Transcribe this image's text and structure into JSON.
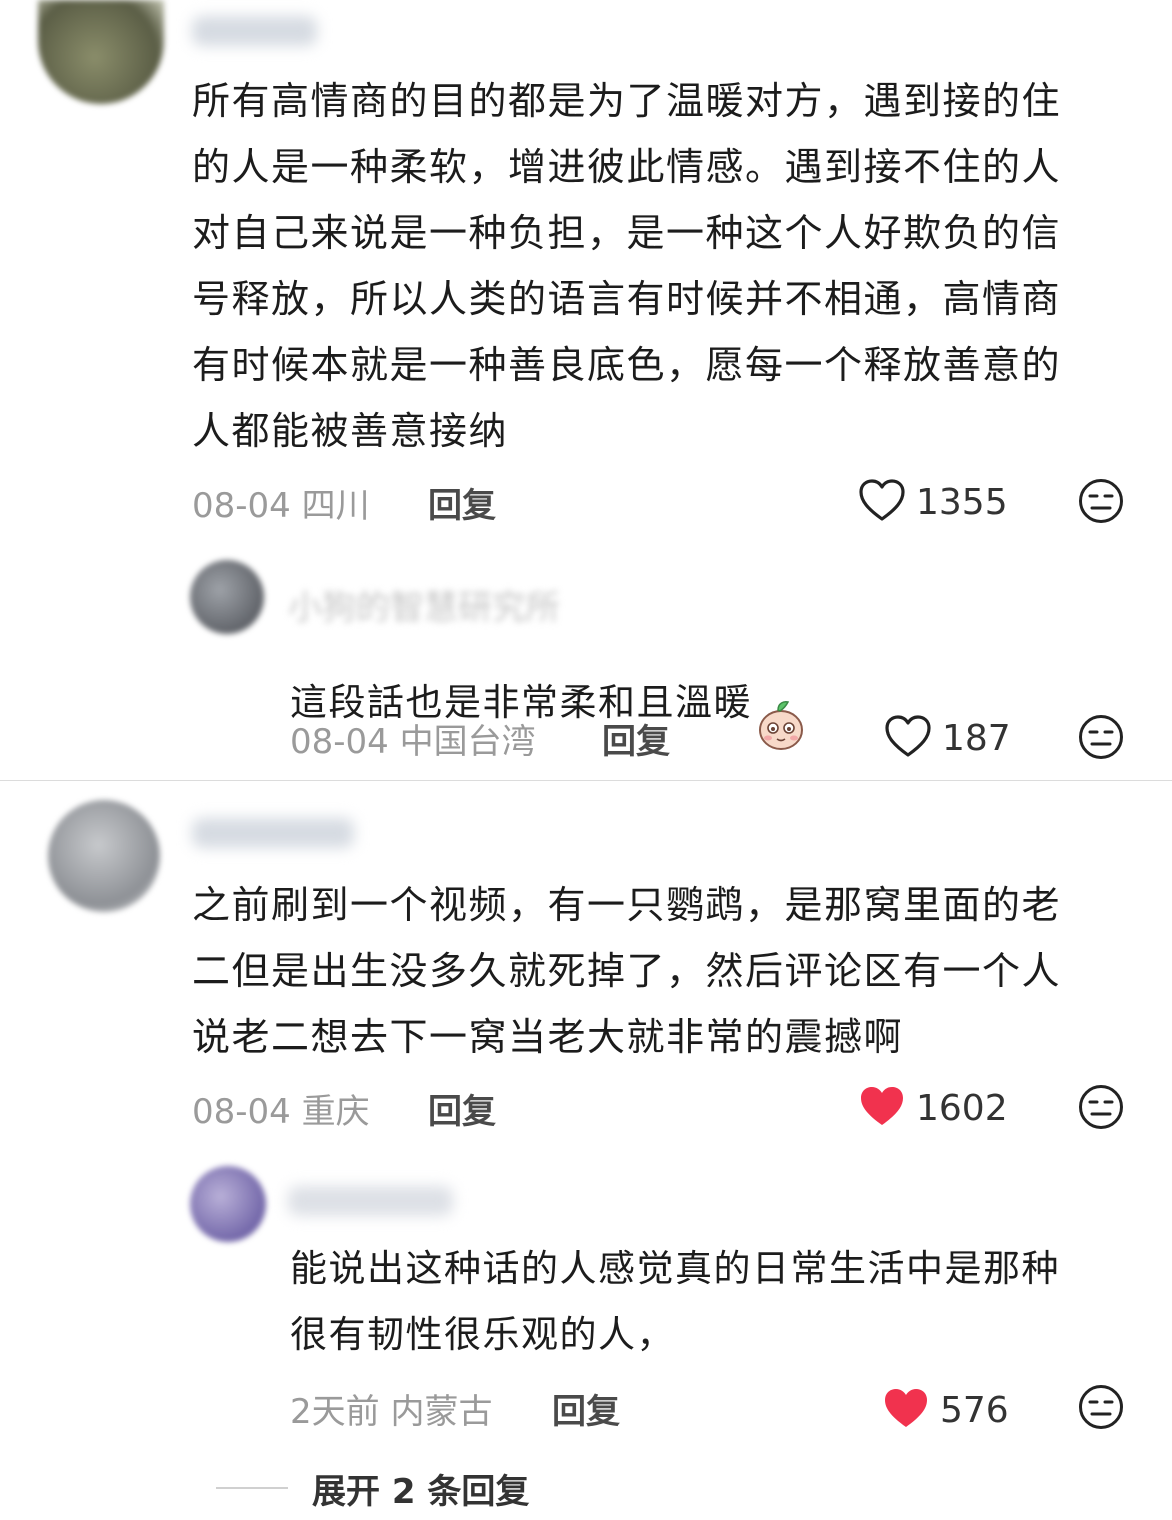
{
  "comments": [
    {
      "text": "所有高情商的目的都是为了温暖对方，遇到接的住\n的人是一种柔软，增进彼此情感。遇到接不住的人\n对自己来说是一种负担，是一种这个人好欺负的信\n号释放，所以人类的语言有时候并不相通，高情商\n有时候本就是一种善良底色，愿每一个释放善意的\n人都能被善意接纳",
      "meta": "08-04 四川",
      "reply": "回复",
      "likes": "1355",
      "liked": false
    },
    {
      "author": "小狗的智慧研究所",
      "text": "這段話也是非常柔和且溫暖",
      "meta": "08-04 中国台湾",
      "reply": "回复",
      "likes": "187",
      "liked": false
    },
    {
      "text": "之前刷到一个视频，有一只鹦鹉，是那窝里面的老\n二但是出生没多久就死掉了，然后评论区有一个人\n说老二想去下一窝当老大就非常的震撼啊",
      "meta": "08-04 重庆",
      "reply": "回复",
      "likes": "1602",
      "liked": true
    },
    {
      "text": "能说出这种话的人感觉真的日常生活中是那种\n很有韧性很乐观的人，",
      "meta": "2天前 内蒙古",
      "reply": "回复",
      "likes": "576",
      "liked": true
    }
  ],
  "expand_replies": "展开 2 条回复",
  "colors": {
    "like_red": "#f1324e",
    "meta_gray": "#9a9a9a"
  },
  "icons": [
    "heart-outline-icon",
    "heart-filled-icon",
    "meh-face-icon",
    "emoji-sticker-icon"
  ]
}
